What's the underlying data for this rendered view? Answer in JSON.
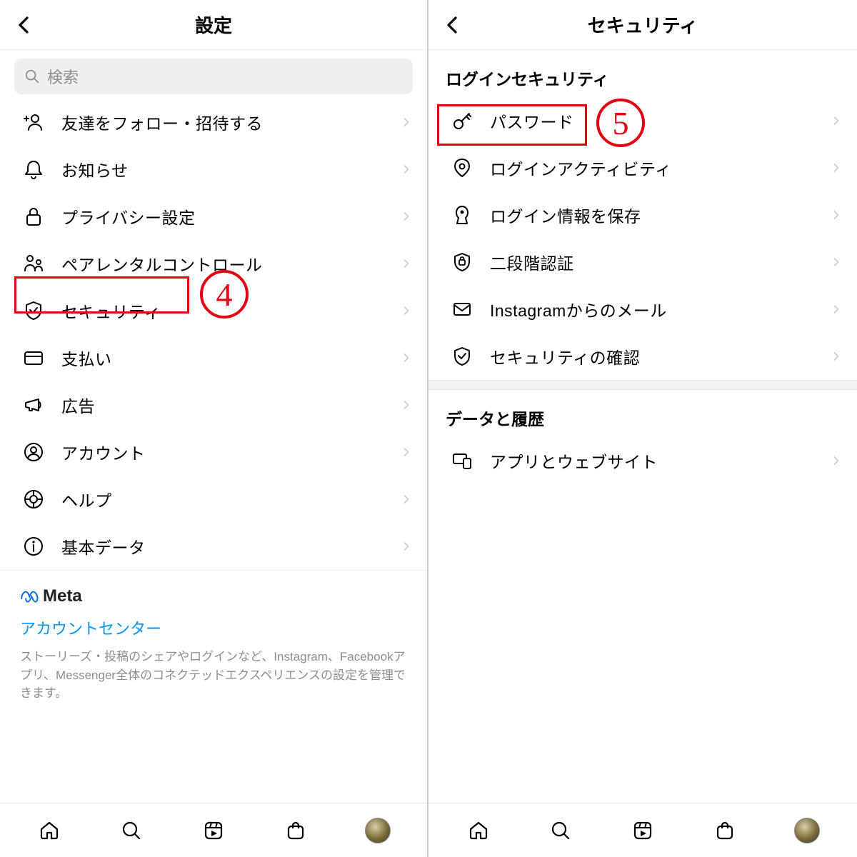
{
  "left": {
    "title": "設定",
    "search_placeholder": "検索",
    "items": [
      {
        "icon": "add-person-icon",
        "label": "友達をフォロー・招待する"
      },
      {
        "icon": "bell-icon",
        "label": "お知らせ"
      },
      {
        "icon": "lock-icon",
        "label": "プライバシー設定"
      },
      {
        "icon": "parental-icon",
        "label": "ペアレンタルコントロール"
      },
      {
        "icon": "shield-check-icon",
        "label": "セキュリティ"
      },
      {
        "icon": "card-icon",
        "label": "支払い"
      },
      {
        "icon": "megaphone-icon",
        "label": "広告"
      },
      {
        "icon": "account-icon",
        "label": "アカウント"
      },
      {
        "icon": "help-icon",
        "label": "ヘルプ"
      },
      {
        "icon": "info-icon",
        "label": "基本データ"
      }
    ],
    "meta_brand": "Meta",
    "accounts_center": "アカウントセンター",
    "meta_desc": "ストーリーズ・投稿のシェアやログインなど、Instagram、Facebookアプリ、Messenger全体のコネクテッドエクスペリエンスの設定を管理できます。",
    "annotation_number": "4"
  },
  "right": {
    "title": "セキュリティ",
    "section1_title": "ログインセキュリティ",
    "section1_items": [
      {
        "icon": "key-icon",
        "label": "パスワード"
      },
      {
        "icon": "pin-icon",
        "label": "ログインアクティビティ"
      },
      {
        "icon": "keyhole-icon",
        "label": "ログイン情報を保存"
      },
      {
        "icon": "shield-2fa-icon",
        "label": "二段階認証"
      },
      {
        "icon": "mail-icon",
        "label": "Instagramからのメール"
      },
      {
        "icon": "shield-check-icon",
        "label": "セキュリティの確認"
      }
    ],
    "section2_title": "データと履歴",
    "section2_items": [
      {
        "icon": "devices-icon",
        "label": "アプリとウェブサイト"
      }
    ],
    "annotation_number": "5"
  }
}
